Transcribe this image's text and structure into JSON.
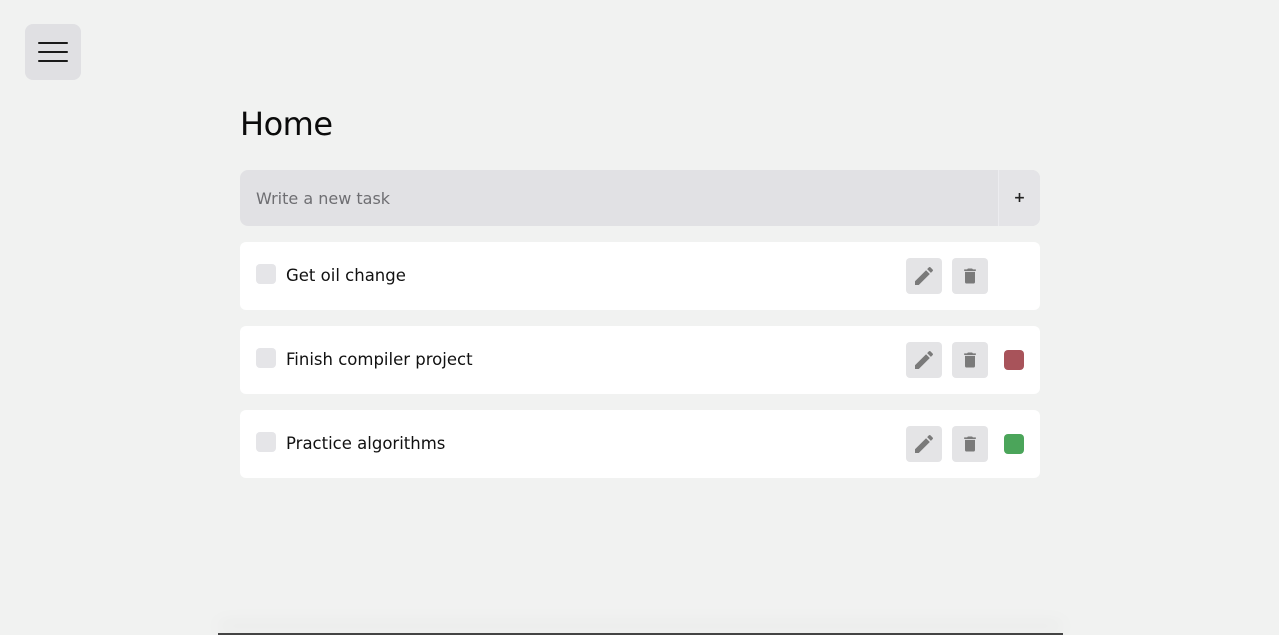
{
  "menu": {
    "icon": "hamburger-menu-icon"
  },
  "page": {
    "title": "Home"
  },
  "new_task": {
    "placeholder": "Write a new task",
    "value": "",
    "add_label": "+"
  },
  "tasks": [
    {
      "label": "Get oil change",
      "checked": false,
      "priority_color": null
    },
    {
      "label": "Finish compiler project",
      "checked": false,
      "priority_color": "#a8535a"
    },
    {
      "label": "Practice algorithms",
      "checked": false,
      "priority_color": "#4ba55a"
    }
  ],
  "icons": {
    "edit": "pencil-icon",
    "delete": "trash-icon"
  },
  "colors": {
    "background": "#f1f2f1",
    "input_bg": "#e1e1e4",
    "icon_button_bg": "#e4e4e6",
    "icon_fill": "#7a7a7a"
  }
}
